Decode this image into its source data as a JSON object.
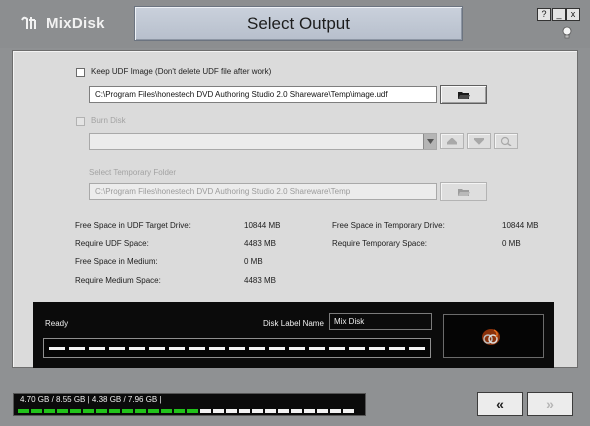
{
  "app": {
    "name": "MixDisk",
    "title": "Select Output",
    "window_buttons": {
      "help": "?",
      "minimize": "_",
      "close": "x"
    }
  },
  "keep_udf": {
    "label": "Keep UDF Image (Don't delete UDF file after work)",
    "path": "C:\\Program Files\\honestech DVD Authoring Studio 2.0 Shareware\\Temp\\image.udf",
    "checked": false
  },
  "burn": {
    "label": "Burn Disk",
    "drive_value": "",
    "checked": false,
    "enabled": false
  },
  "temp": {
    "label": "Select Temporary Folder",
    "path": "C:\\Program Files\\honestech DVD Authoring Studio 2.0 Shareware\\Temp"
  },
  "info": {
    "free_udf_label": "Free Space in UDF Target Drive:",
    "free_udf_value": "10844 MB",
    "req_udf_label": "Require UDF Space:",
    "req_udf_value": "4483 MB",
    "free_medium_label": "Free Space in Medium:",
    "free_medium_value": "0 MB",
    "req_medium_label": "Require Medium Space:",
    "req_medium_value": "4483 MB",
    "free_temp_label": "Free Space in Temporary Drive:",
    "free_temp_value": "10844 MB",
    "req_temp_label": "Require Temporary Space:",
    "req_temp_value": "0 MB"
  },
  "status": {
    "text": "Ready",
    "disk_label_caption": "Disk Label Name",
    "disk_label_value": "Mix Disk",
    "progress": 0
  },
  "capacity": {
    "text": "4.70 GB / 8.55 GB | 4.38 GB / 7.96 GB |",
    "used_fraction": 0.55
  },
  "nav": {
    "back": "«",
    "next": "»"
  },
  "colors": {
    "accent_green": "#21c21a",
    "panel": "#dbdbdb",
    "header": "#8c8e90"
  }
}
